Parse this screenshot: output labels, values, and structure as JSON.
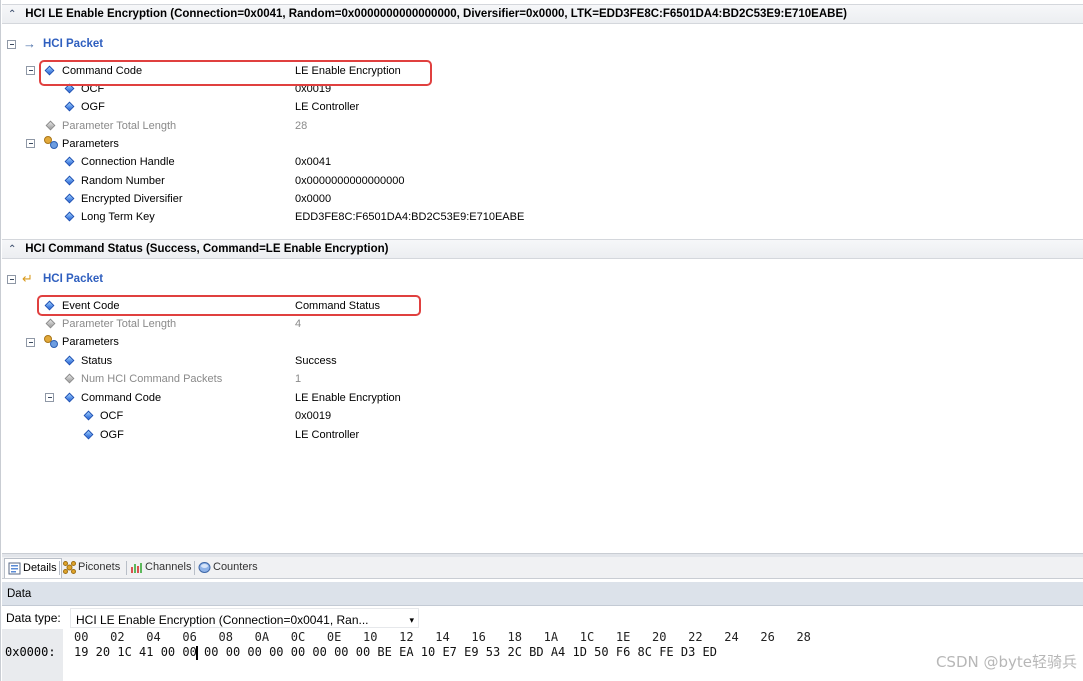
{
  "event1": {
    "header": "HCI LE Enable Encryption (Connection=0x0041, Random=0x0000000000000000, Diversifier=0x0000, LTK=EDD3FE8C:F6501DA4:BD2C53E9:E710EABE)",
    "packet_label": "HCI Packet",
    "command_code": {
      "label": "Command Code",
      "value": "LE Enable Encryption"
    },
    "ocf": {
      "label": "OCF",
      "value": "0x0019"
    },
    "ogf": {
      "label": "OGF",
      "value": "LE Controller"
    },
    "param_total_length": {
      "label": "Parameter Total Length",
      "value": "28"
    },
    "parameters_label": "Parameters",
    "connection_handle": {
      "label": "Connection Handle",
      "value": "0x0041"
    },
    "random_number": {
      "label": "Random Number",
      "value": "0x0000000000000000"
    },
    "encrypted_diversifier": {
      "label": "Encrypted Diversifier",
      "value": "0x0000"
    },
    "long_term_key": {
      "label": "Long Term Key",
      "value": "EDD3FE8C:F6501DA4:BD2C53E9:E710EABE"
    }
  },
  "event2": {
    "header": "HCI Command Status (Success, Command=LE Enable Encryption)",
    "packet_label": "HCI Packet",
    "event_code": {
      "label": "Event Code",
      "value": "Command Status"
    },
    "param_total_length": {
      "label": "Parameter Total Length",
      "value": "4"
    },
    "parameters_label": "Parameters",
    "status": {
      "label": "Status",
      "value": "Success"
    },
    "num_hci_packets": {
      "label": "Num HCI Command Packets",
      "value": "1"
    },
    "command_code": {
      "label": "Command Code",
      "value": "LE Enable Encryption"
    },
    "ocf": {
      "label": "OCF",
      "value": "0x0019"
    },
    "ogf": {
      "label": "OGF",
      "value": "LE Controller"
    }
  },
  "tabs": [
    {
      "label": "Details",
      "icon": "details-icon",
      "active": true
    },
    {
      "label": "Piconets",
      "icon": "piconets-icon",
      "active": false
    },
    {
      "label": "Channels",
      "icon": "channels-icon",
      "active": false
    },
    {
      "label": "Counters",
      "icon": "counters-icon",
      "active": false
    }
  ],
  "data_panel": {
    "header": "Data",
    "type_label": "Data type:",
    "type_value": "HCI LE Enable Encryption (Connection=0x0041, Ran..."
  },
  "hex": {
    "column_header": "00   02   04   06   08   0A   0C   0E   10   12   14   16   18   1A   1C   1E   20   22   24   26   28",
    "address": "0x0000:",
    "bytes": "19 20 1C 41 00 00 00 00 00 00 00 00 00 00 BE EA 10 E7 E9 53 2C BD A4 1D 50 F6 8C FE D3 ED"
  },
  "watermark": "CSDN @byte轻骑兵",
  "colors": {
    "highlight": "#e0403f",
    "packet_label": "#2f5fbf",
    "diamond": "#1f5fd6"
  }
}
